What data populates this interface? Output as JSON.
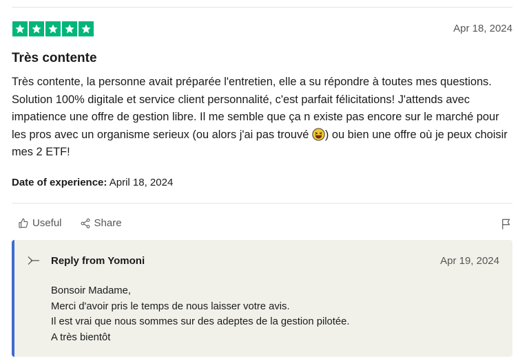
{
  "review": {
    "rating": 5,
    "date": "Apr 18, 2024",
    "title": "Très contente",
    "body_part1": "Très contente, la personne avait préparée l'entretien, elle a su répondre à toutes mes questions. Solution 100% digitale et service client personnalité, c'est parfait félicitations! J'attends avec impatience une offre de gestion libre. Il me semble que ça n existe pas encore sur le marché pour les pros avec un organisme serieux (ou alors j'ai pas trouvé ",
    "body_part2": ") ou bien une offre où je peux choisir mes 2 ETF!",
    "experience_label": "Date of experience:",
    "experience_date": "April 18, 2024"
  },
  "actions": {
    "useful_label": "Useful",
    "share_label": "Share"
  },
  "reply": {
    "from": "Reply from Yomoni",
    "date": "Apr 19, 2024",
    "lines": [
      "Bonsoir Madame,",
      "Merci d'avoir pris le temps de nous laisser votre avis.",
      "Il est vrai que nous sommes sur des adeptes de la gestion pilotée.",
      "A très bientôt"
    ]
  },
  "colors": {
    "star_green": "#00b67a",
    "reply_accent": "#3d6bcf",
    "reply_bg": "#f1f1ea"
  }
}
